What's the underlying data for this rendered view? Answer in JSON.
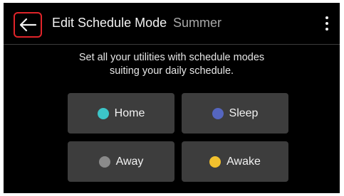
{
  "header": {
    "title": "Edit Schedule Mode",
    "subtitle": "Summer",
    "back_icon": "arrow-left-icon",
    "menu_icon": "more-vertical-icon",
    "back_highlight_color": "#e0242a"
  },
  "description": {
    "line1": "Set all your utilities with schedule modes",
    "line2": "suiting your daily schedule."
  },
  "modes": [
    {
      "label": "Home",
      "color": "#3cc5c8"
    },
    {
      "label": "Sleep",
      "color": "#5566c0"
    },
    {
      "label": "Away",
      "color": "#8a8a8a"
    },
    {
      "label": "Awake",
      "color": "#f2c12e"
    }
  ]
}
